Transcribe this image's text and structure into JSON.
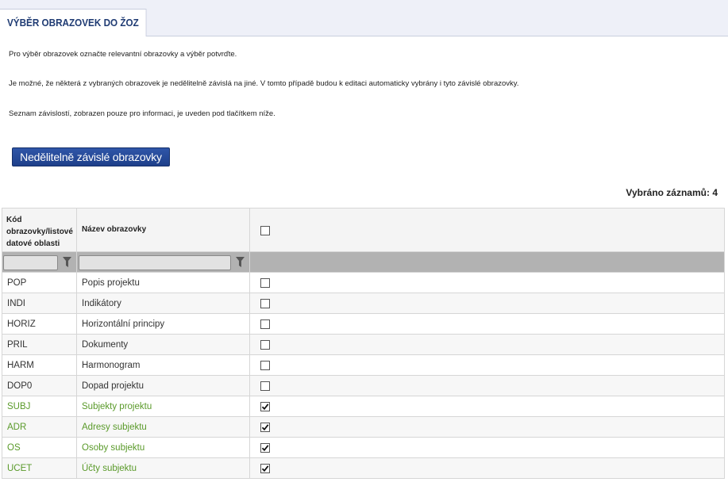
{
  "tab": {
    "title": "VÝBĚR OBRAZOVEK DO ŽOZ"
  },
  "instructions": {
    "line1": "Pro výběr obrazovek označte relevantní obrazovky a výběr potvrďte.",
    "line2": "Je možné, že některá z vybraných obrazovek je nedělitelně závislá na jiné. V tomto případě budou k editaci automaticky vybrány i tyto závislé obrazovky.",
    "line3": "Seznam závislostí, zobrazen pouze pro informaci, je uveden pod tlačítkem níže."
  },
  "dependency_button": {
    "label": "Nedělitelně závislé obrazovky"
  },
  "selection_count": {
    "text": "Vybráno záznamů: 4"
  },
  "table": {
    "columns": [
      "Kód obrazovky/listové datové oblasti",
      "Název obrazovky"
    ],
    "header_checkbox_checked": false,
    "rows": [
      {
        "code": "POP",
        "name": "Popis projektu",
        "checked": false
      },
      {
        "code": "INDI",
        "name": "Indikátory",
        "checked": false
      },
      {
        "code": "HORIZ",
        "name": "Horizontální principy",
        "checked": false
      },
      {
        "code": "PRIL",
        "name": "Dokumenty",
        "checked": false
      },
      {
        "code": "HARM",
        "name": "Harmonogram",
        "checked": false
      },
      {
        "code": "DOP0",
        "name": "Dopad projektu",
        "checked": false
      },
      {
        "code": "SUBJ",
        "name": "Subjekty projektu",
        "checked": true
      },
      {
        "code": "ADR",
        "name": "Adresy subjektu",
        "checked": true
      },
      {
        "code": "OS",
        "name": "Osoby subjektu",
        "checked": true
      },
      {
        "code": "UCET",
        "name": "Účty subjektu",
        "checked": true
      }
    ]
  },
  "colors": {
    "selected_text": "#5a9a2a",
    "button": "#1e3f8a",
    "tab_text": "#1f3b73"
  }
}
